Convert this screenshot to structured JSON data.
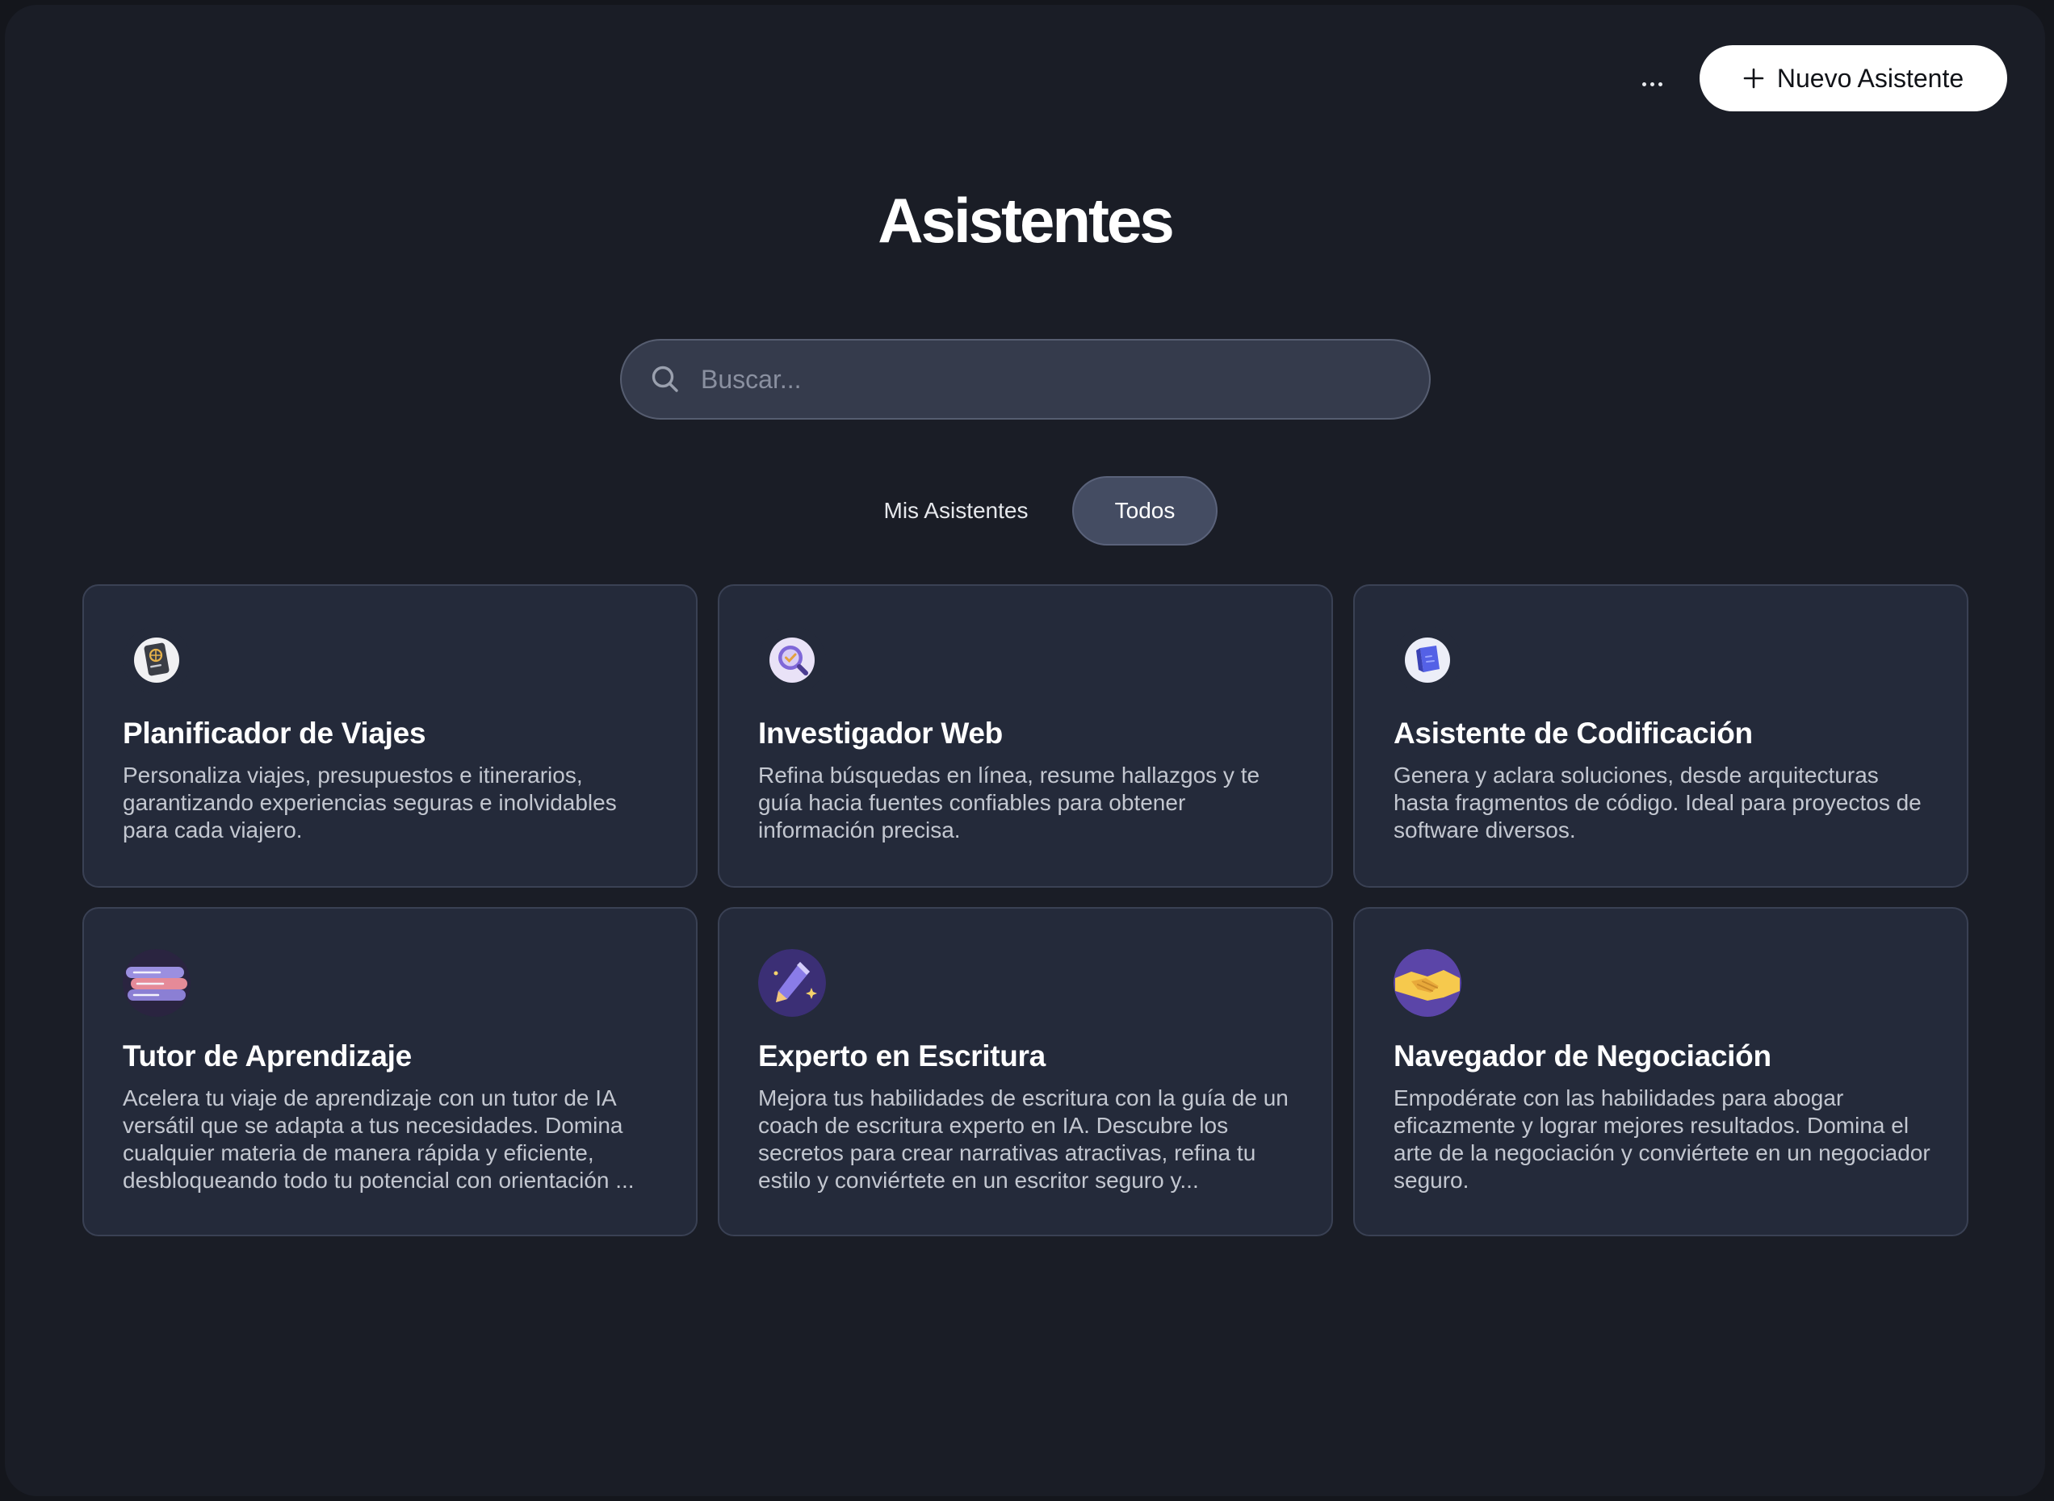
{
  "header": {
    "more_icon": "ellipsis-icon",
    "new_button": {
      "label": "Nuevo Asistente",
      "icon": "plus-icon"
    }
  },
  "page": {
    "title": "Asistentes"
  },
  "search": {
    "placeholder": "Buscar...",
    "value": "",
    "icon": "search-icon"
  },
  "tabs": [
    {
      "label": "Mis Asistentes",
      "active": false
    },
    {
      "label": "Todos",
      "active": true
    }
  ],
  "assistants": [
    {
      "icon": "passport-icon",
      "title": "Planificador de Viajes",
      "description": "Personaliza viajes, presupuestos e itinerarios, garantizando experiencias seguras e inolvidables para cada viajero."
    },
    {
      "icon": "magnifier-check-icon",
      "title": "Investigador Web",
      "description": "Refina búsquedas en línea, resume hallazgos y te guía hacia fuentes confiables para obtener información precisa."
    },
    {
      "icon": "code-cube-icon",
      "title": "Asistente de Codificación",
      "description": "Genera y aclara soluciones, desde arquitecturas hasta fragmentos de código. Ideal para proyectos de software diversos."
    },
    {
      "icon": "books-icon",
      "title": "Tutor de Aprendizaje",
      "description": "Acelera tu viaje de aprendizaje con un tutor de IA versátil que se adapta a tus necesidades. Domina cualquier materia de manera rápida y eficiente, desbloqueando todo tu potencial con orientación ..."
    },
    {
      "icon": "pencil-sparkle-icon",
      "title": "Experto en Escritura",
      "description": "Mejora tus habilidades de escritura con la guía de un coach de escritura experto en IA. Descubre los secretos para crear narrativas atractivas, refina tu estilo y conviértete en un escritor seguro y..."
    },
    {
      "icon": "handshake-icon",
      "title": "Navegador de Negociación",
      "description": "Empodérate con las habilidades para abogar eficazmente y lograr mejores resultados. Domina el arte de la negociación y conviértete en un negociador seguro."
    }
  ]
}
